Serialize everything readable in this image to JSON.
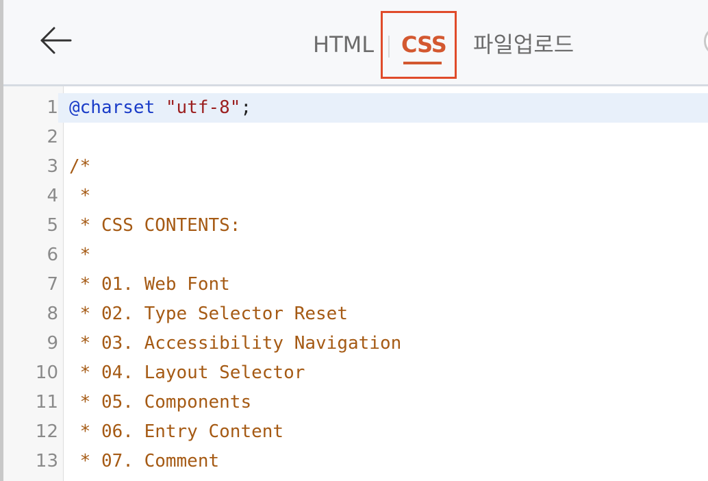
{
  "header": {
    "tabs": [
      {
        "label": "HTML",
        "selected": false
      },
      {
        "label": "CSS",
        "selected": true
      },
      {
        "label": "파일업로드",
        "selected": false
      }
    ],
    "icons": {
      "back": "back-arrow-icon"
    },
    "colors": {
      "active_tab": "#d35830",
      "highlight_box": "#e04b2a",
      "header_bg": "#f7f8fa"
    }
  },
  "editor": {
    "colors": {
      "at_rule": "#1a3cc8",
      "string": "#9b1e1e",
      "comment": "#a55a14",
      "line_number": "#8a8a8a",
      "active_line_bg": "#e8f0fa"
    },
    "lines": [
      {
        "num": "1",
        "at": "@charset",
        "sp": " ",
        "str": "\"utf-8\"",
        "punct": ";"
      },
      {
        "num": "2",
        "text": ""
      },
      {
        "num": "3",
        "text": "/*"
      },
      {
        "num": "4",
        "text": " *"
      },
      {
        "num": "5",
        "text": " * CSS CONTENTS:"
      },
      {
        "num": "6",
        "text": " *"
      },
      {
        "num": "7",
        "text": " * 01. Web Font"
      },
      {
        "num": "8",
        "text": " * 02. Type Selector Reset"
      },
      {
        "num": "9",
        "text": " * 03. Accessibility Navigation"
      },
      {
        "num": "10",
        "text": " * 04. Layout Selector"
      },
      {
        "num": "11",
        "text": " * 05. Components"
      },
      {
        "num": "12",
        "text": " * 06. Entry Content"
      },
      {
        "num": "13",
        "text": " * 07. Comment"
      }
    ]
  }
}
